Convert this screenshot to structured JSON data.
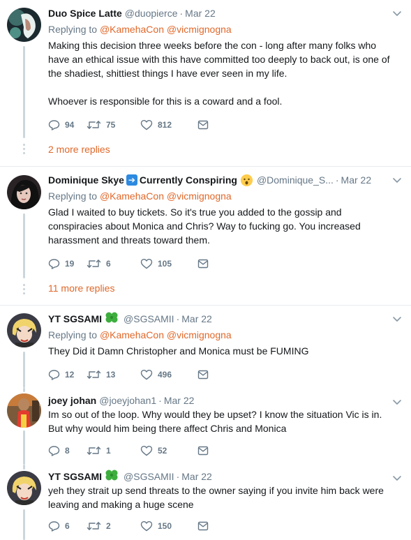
{
  "tweets": [
    {
      "name": "Duo Spice Latte",
      "handle": "@duopierce",
      "dot": "·",
      "date": "Mar 22",
      "replying_label": "Replying to",
      "mentions": [
        "@KamehaCon",
        "@vicmignogna"
      ],
      "lines": [
        "Making this decision three weeks before the con - long after many folks who",
        "have an ethical issue with this have committed too deeply to back out, is one of",
        "the shadiest, shittiest things I have ever seen in my life.",
        "",
        "Whoever is responsible for this is a coward and a fool."
      ],
      "replies": "94",
      "retweets": "75",
      "likes": "812",
      "more_replies": "2 more replies"
    },
    {
      "name": "Dominique Skye",
      "name_suffix": "Currently Conspiring",
      "handle": "@Dominique_S...",
      "dot": "·",
      "date": "Mar 22",
      "replying_label": "Replying to",
      "mentions": [
        "@KamehaCon",
        "@vicmignogna"
      ],
      "lines": [
        "Glad I waited to buy tickets. So it's true you added to the gossip and",
        "conspiracies about Monica and Chris? Way to fucking go. You increased",
        "harassment and threats toward them."
      ],
      "replies": "19",
      "retweets": "6",
      "likes": "105",
      "more_replies": "11 more replies"
    },
    {
      "name": "YT SGSAMI",
      "handle": "@SGSAMII",
      "dot": "·",
      "date": "Mar 22",
      "replying_label": "Replying to",
      "mentions": [
        "@KamehaCon",
        "@vicmignogna"
      ],
      "lines": [
        "They Did it Damn Christopher and Monica must be FUMING"
      ],
      "replies": "12",
      "retweets": "13",
      "likes": "496"
    },
    {
      "name": "joey johan",
      "handle": "@joeyjohan1",
      "dot": "·",
      "date": "Mar 22",
      "lines": [
        "Im so out of the loop. Why would they be upset? I know the situation Vic is in.",
        "But why would him being there affect Chris and Monica"
      ],
      "replies": "8",
      "retweets": "1",
      "likes": "52"
    },
    {
      "name": "YT SGSAMI",
      "handle": "@SGSAMII",
      "dot": "·",
      "date": "Mar 22",
      "lines": [
        "yeh they strait up send threats to the owner saying if you invite him back were",
        "leaving and making a huge scene"
      ],
      "replies": "6",
      "retweets": "2",
      "likes": "150"
    }
  ],
  "icons": {
    "reply": "reply-icon",
    "retweet": "retweet-icon",
    "like": "heart-icon",
    "dm": "envelope-icon",
    "caret": "chevron-down-icon"
  },
  "colors": {
    "mention": "#e0682a",
    "secondary_text": "#657786",
    "thread_line": "#ccd6dd"
  }
}
